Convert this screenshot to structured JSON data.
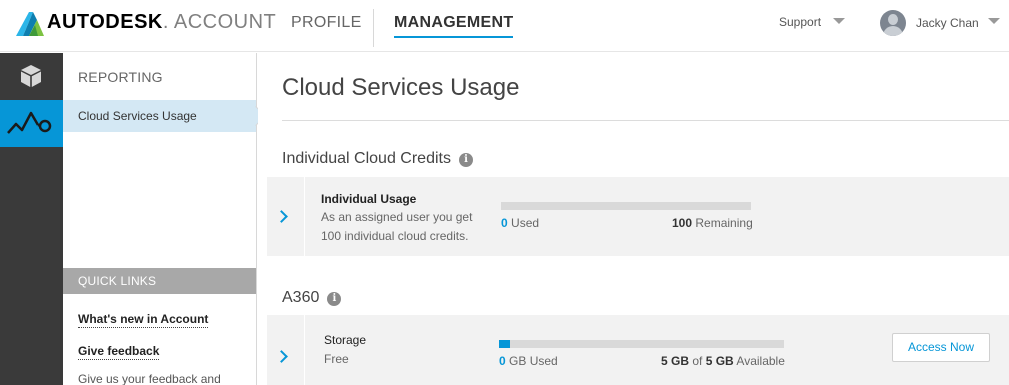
{
  "header": {
    "brand_bold": "AUTODESK",
    "brand_light": ". ACCOUNT",
    "nav": {
      "profile": "PROFILE",
      "management": "MANAGEMENT"
    },
    "support": "Support",
    "user_name": "Jacky Chan"
  },
  "rail": [
    {
      "icon": "box-icon",
      "active": false
    },
    {
      "icon": "usage-chart-icon",
      "active": true
    }
  ],
  "sidebar": {
    "section_title": "REPORTING",
    "items": [
      {
        "label": "Cloud Services Usage",
        "active": true
      }
    ],
    "quick_links": {
      "title": "QUICK LINKS",
      "links": [
        "What's new in Account",
        "Give feedback"
      ],
      "feedback_text": "Give us your feedback and"
    }
  },
  "main": {
    "title": "Cloud Services Usage",
    "sections": [
      {
        "title": "Individual Cloud Credits",
        "card": {
          "title": "Individual Usage",
          "description_line1": "As an assigned user you get",
          "description_line2": "100 individual cloud credits.",
          "used_value": "0",
          "used_label": "Used",
          "remaining_value": "100",
          "remaining_label": "Remaining",
          "used_fraction": 0
        }
      },
      {
        "title": "A360",
        "card": {
          "title": "Storage",
          "subtitle": "Free",
          "used_value": "0",
          "used_label": "GB Used",
          "available_used": "5 GB",
          "of_label": "of",
          "available_total": "5 GB",
          "available_label": "Available",
          "used_fraction": 0.04,
          "button_label": "Access Now"
        }
      }
    ]
  },
  "colors": {
    "accent": "#0696d7",
    "rail": "#3a3a3a",
    "active_nav": "#d4e8f4",
    "quick_links_header": "#a8a8a8"
  }
}
